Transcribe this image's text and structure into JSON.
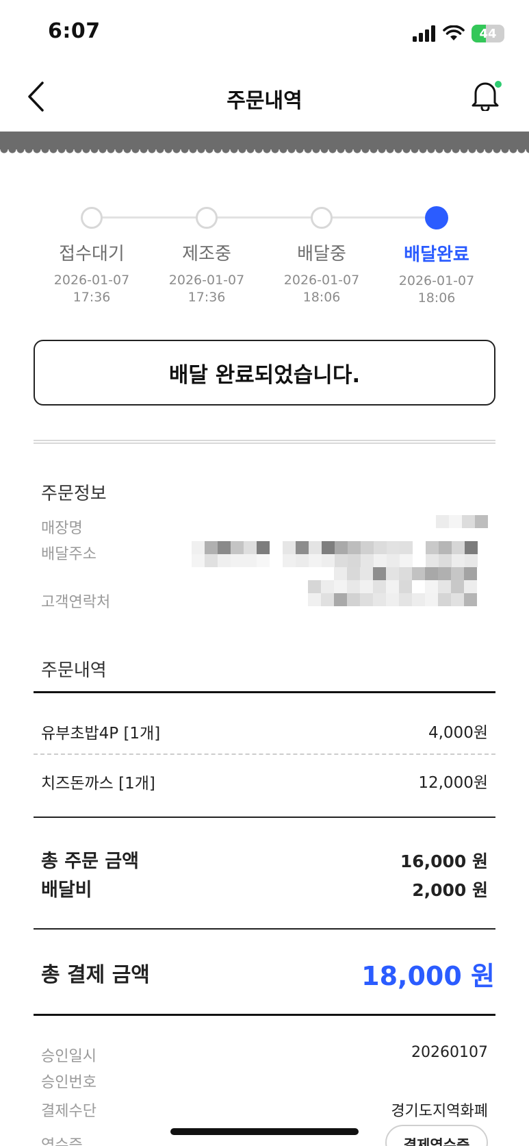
{
  "status_bar": {
    "time": "6:07",
    "battery": "44",
    "battery_level": 0.44
  },
  "header": {
    "title": "주문내역",
    "back_icon": "chevron-left-icon",
    "bell_icon": "bell-icon",
    "notification_dot_color": "#2ecc71"
  },
  "steps": [
    {
      "label": "접수대기",
      "date": "2026-01-07",
      "time": "17:36",
      "active": false
    },
    {
      "label": "제조중",
      "date": "2026-01-07",
      "time": "17:36",
      "active": false
    },
    {
      "label": "배달중",
      "date": "2026-01-07",
      "time": "18:06",
      "active": false
    },
    {
      "label": "배달완료",
      "date": "2026-01-07",
      "time": "18:06",
      "active": true
    }
  ],
  "status_message": "배달 완료되었습니다.",
  "order_info": {
    "title": "주문정보",
    "store_label": "매장명",
    "address_label": "배달주소",
    "phone_label": "고객연락처"
  },
  "order_items": {
    "title": "주문내역",
    "items": [
      {
        "name": "유부초밥4P [1개]",
        "price": "4,000원"
      },
      {
        "name": "치즈돈까스 [1개]",
        "price": "12,000원"
      }
    ]
  },
  "summary": {
    "order_total_label": "총 주문 금액",
    "order_total_value": "16,000 원",
    "delivery_fee_label": "배달비",
    "delivery_fee_value": "2,000 원",
    "payment_total_label": "총 결제 금액",
    "payment_total_value": "18,000 원"
  },
  "payment": {
    "approval_date_label": "승인일시",
    "approval_date_value": "20260107",
    "approval_no_label": "승인번호",
    "method_label": "결제수단",
    "method_value": "경기도지역화폐",
    "receipt_label": "영수증",
    "receipt_button": "결제영수증"
  },
  "colors": {
    "accent": "#2b5cff",
    "band": "#6c6c6c"
  }
}
